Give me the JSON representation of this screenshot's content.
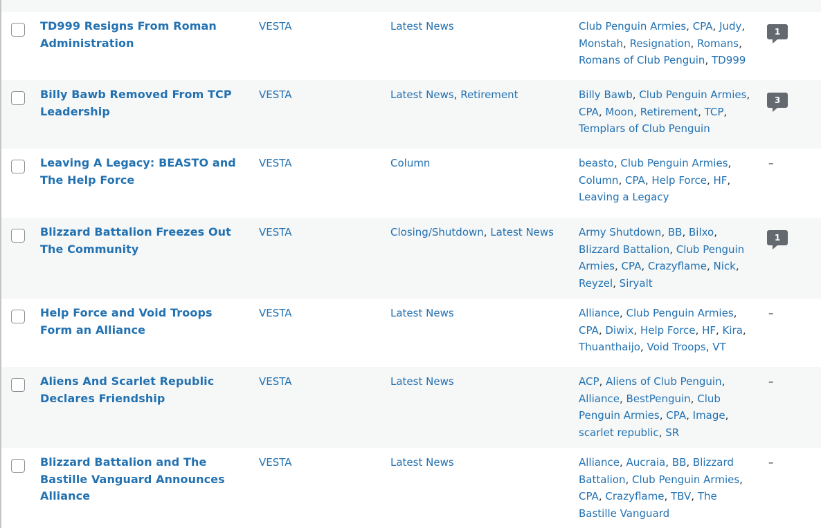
{
  "posts": [
    {
      "title": "TD999 Resigns From Roman Administration",
      "author": "VESTA",
      "categories": [
        "Latest News"
      ],
      "tags": [
        "Club Penguin Armies",
        "CPA",
        "Judy",
        "Monstah",
        "Resignation",
        "Romans",
        "Romans of Club Penguin",
        "TD999"
      ],
      "comments": "1"
    },
    {
      "title": "Billy Bawb Removed From TCP Leadership",
      "author": "VESTA",
      "categories": [
        "Latest News",
        "Retirement"
      ],
      "tags": [
        "Billy Bawb",
        "Club Penguin Armies",
        "CPA",
        "Moon",
        "Retirement",
        "TCP",
        "Templars of Club Penguin"
      ],
      "comments": "3"
    },
    {
      "title": "Leaving A Legacy: BEASTO and The Help Force",
      "author": "VESTA",
      "categories": [
        "Column"
      ],
      "tags": [
        "beasto",
        "Club Penguin Armies",
        "Column",
        "CPA",
        "Help Force",
        "HF",
        "Leaving a Legacy"
      ],
      "comments": "–"
    },
    {
      "title": "Blizzard Battalion Freezes Out The Community",
      "author": "VESTA",
      "categories": [
        "Closing/Shutdown",
        "Latest News"
      ],
      "tags": [
        "Army Shutdown",
        "BB",
        "Bilxo",
        "Blizzard Battalion",
        "Club Penguin Armies",
        "CPA",
        "Crazyflame",
        "Nick",
        "Reyzel",
        "Siryalt"
      ],
      "comments": "1"
    },
    {
      "title": "Help Force and Void Troops Form an Alliance",
      "author": "VESTA",
      "categories": [
        "Latest News"
      ],
      "tags": [
        "Alliance",
        "Club Penguin Armies",
        "CPA",
        "Diwix",
        "Help Force",
        "HF",
        "Kira",
        "Thuanthaijo",
        "Void Troops",
        "VT"
      ],
      "comments": "–"
    },
    {
      "title": "Aliens And Scarlet Republic Declares Friendship",
      "author": "VESTA",
      "categories": [
        "Latest News"
      ],
      "tags": [
        "ACP",
        "Aliens of Club Penguin",
        "Alliance",
        "BestPenguin",
        "Club Penguin Armies",
        "CPA",
        "Image",
        "scarlet republic",
        "SR"
      ],
      "comments": "–"
    },
    {
      "title": "Blizzard Battalion and The Bastille Vanguard Announces Alliance",
      "author": "VESTA",
      "categories": [
        "Latest News"
      ],
      "tags": [
        "Alliance",
        "Aucraia",
        "BB",
        "Blizzard Battalion",
        "Club Penguin Armies",
        "CPA",
        "Crazyflame",
        "TBV",
        "The Bastille Vanguard"
      ],
      "comments": "–"
    }
  ]
}
